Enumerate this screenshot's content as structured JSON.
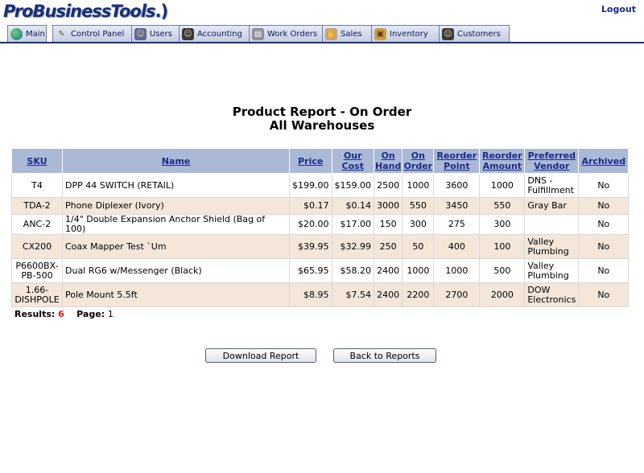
{
  "app": {
    "logo_text": "ProBusinessTools",
    "logo_suffix": ".)",
    "logout": "Logout"
  },
  "nav": {
    "tabs": [
      {
        "label": "Main",
        "icon": "globe-icon"
      },
      {
        "label": "Control Panel",
        "icon": "wrench-icon"
      },
      {
        "label": "Users",
        "icon": "users-icon"
      },
      {
        "label": "Accounting",
        "icon": "accountant-icon"
      },
      {
        "label": "Work Orders",
        "icon": "work-orders-icon"
      },
      {
        "label": "Sales",
        "icon": "sales-icon"
      },
      {
        "label": "Inventory",
        "icon": "inventory-icon"
      },
      {
        "label": "Customers",
        "icon": "customers-icon"
      }
    ]
  },
  "report": {
    "title": "Product Report - On Order",
    "subtitle": "All Warehouses",
    "columns": {
      "sku": "SKU",
      "name": "Name",
      "price": "Price",
      "our_cost_1": "Our",
      "our_cost_2": "Cost",
      "on_hand_1": "On",
      "on_hand_2": "Hand",
      "on_order_1": "On",
      "on_order_2": "Order",
      "reorder_point_1": "Reorder",
      "reorder_point_2": "Point",
      "reorder_amount_1": "Reorder",
      "reorder_amount_2": "Amount",
      "preferred_vendor_1": "Preferred",
      "preferred_vendor_2": "Vendor",
      "archived": "Archived"
    },
    "rows": [
      {
        "sku1": "T4",
        "sku2": "",
        "name": "DPP 44 SWITCH (RETAIL)",
        "price": "$199.00",
        "cost": "$159.00",
        "on_hand": "2500",
        "on_order": "1000",
        "reorder_point": "3600",
        "reorder_amount": "1000",
        "vendor1": "DNS -",
        "vendor2": "Fulfillment",
        "archived": "No"
      },
      {
        "sku1": "TDA-2",
        "sku2": "",
        "name": "Phone Diplexer (Ivory)",
        "price": "$0.17",
        "cost": "$0.14",
        "on_hand": "3000",
        "on_order": "550",
        "reorder_point": "3450",
        "reorder_amount": "550",
        "vendor1": "Gray Bar",
        "vendor2": "",
        "archived": "No"
      },
      {
        "sku1": "ANC-2",
        "sku2": "",
        "name": "1/4\" Double Expansion Anchor Shield (Bag of 100)",
        "price": "$20.00",
        "cost": "$17.00",
        "on_hand": "150",
        "on_order": "300",
        "reorder_point": "275",
        "reorder_amount": "300",
        "vendor1": "",
        "vendor2": "",
        "archived": "No"
      },
      {
        "sku1": "CX200",
        "sku2": "",
        "name": "Coax Mapper Test `Um",
        "price": "$39.95",
        "cost": "$32.99",
        "on_hand": "250",
        "on_order": "50",
        "reorder_point": "400",
        "reorder_amount": "100",
        "vendor1": "Valley",
        "vendor2": "Plumbing",
        "archived": "No"
      },
      {
        "sku1": "P6600BX-",
        "sku2": "PB-500",
        "name": "Dual RG6 w/Messenger (Black)",
        "price": "$65.95",
        "cost": "$58.20",
        "on_hand": "2400",
        "on_order": "1000",
        "reorder_point": "1000",
        "reorder_amount": "500",
        "vendor1": "Valley",
        "vendor2": "Plumbing",
        "archived": "No"
      },
      {
        "sku1": "1.66-",
        "sku2": "DISHPOLE",
        "name": "Pole Mount 5.5ft",
        "price": "$8.95",
        "cost": "$7.54",
        "on_hand": "2400",
        "on_order": "2200",
        "reorder_point": "2700",
        "reorder_amount": "2000",
        "vendor1": "DOW",
        "vendor2": "Electronics",
        "archived": "No"
      }
    ],
    "results_label": "Results:",
    "results_count": "6",
    "page_label": "Page:",
    "page_number": "1"
  },
  "actions": {
    "download": "Download Report",
    "back": "Back to Reports"
  },
  "colors": {
    "header_bg": "#a9b9d6",
    "row_alt": "#f4e6d9",
    "link": "#1c2a8a",
    "count": "#c81e1e",
    "nav_line": "#1f2f7f"
  }
}
